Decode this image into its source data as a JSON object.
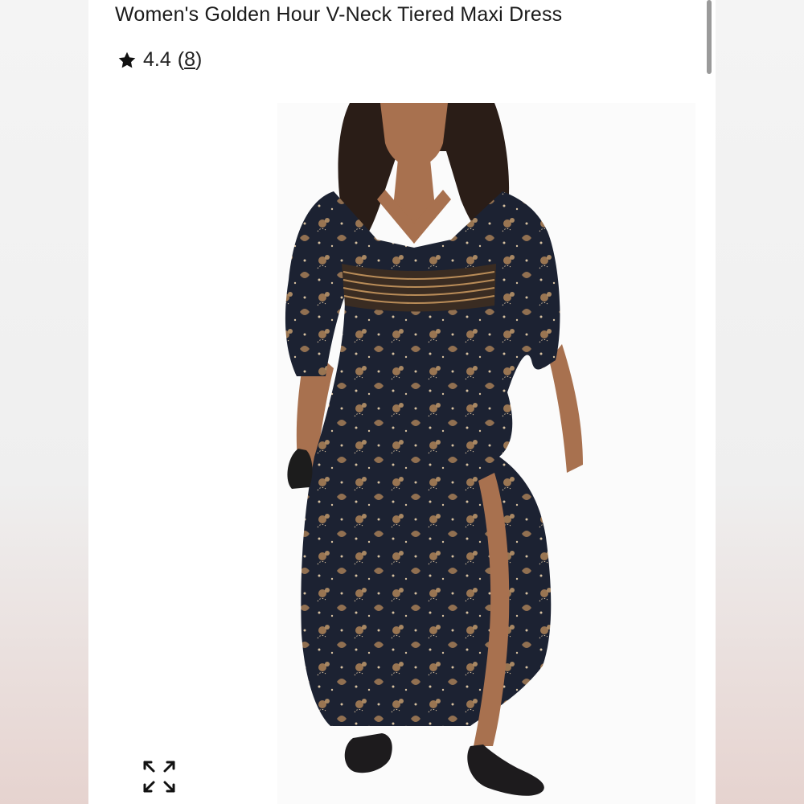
{
  "product": {
    "title": "Women's Golden Hour V-Neck Tiered Maxi Dress",
    "rating_value": "4.4",
    "review_count_open": "(",
    "review_count": "8",
    "review_count_close": ")"
  },
  "icons": {
    "rating": "star-icon",
    "expand": "expand-arrows-icon"
  },
  "colors": {
    "dress": "#1c2232",
    "print": "#b8895a",
    "skin": "#a8714f",
    "hair": "#2a1d17"
  }
}
